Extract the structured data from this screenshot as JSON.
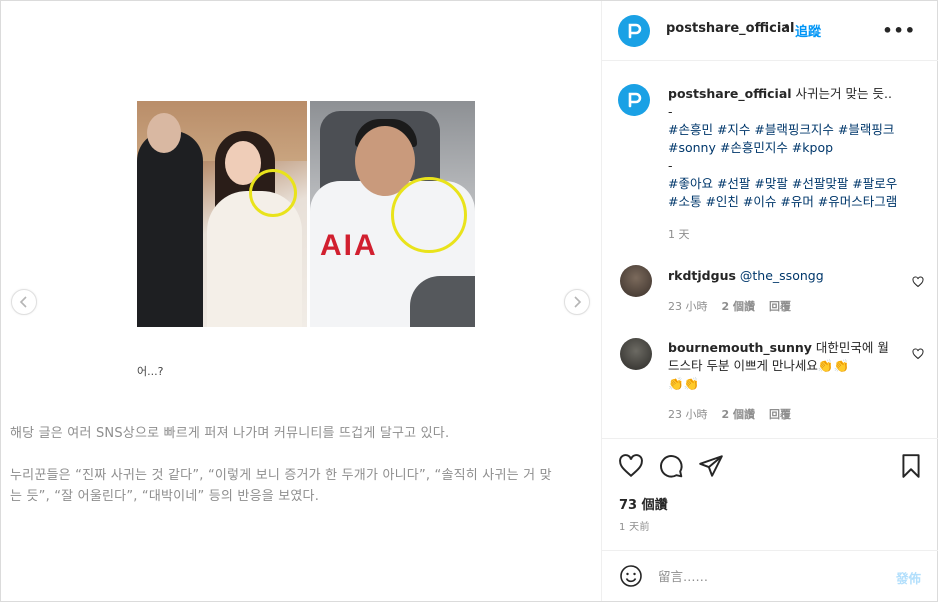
{
  "post": {
    "caption_small": "어...?",
    "body_line1": "해당 글은 여러 SNS상으로 빠르게 퍼져 나가며 커뮤니티를 뜨겁게 달구고 있다.",
    "body_line2": "누리꾼들은 “진짜 사귀는 것 같다”, “이렇게 보니 증거가 한 두개가 아니다”, “솔직히 사귀는 거 맞",
    "body_line3": "는 듯”, “잘 어울린다”, “대박이네” 등의 반응을 보였다.",
    "photo_text": "AIA"
  },
  "header": {
    "username": "postshare_official",
    "separator": "•",
    "follow_label": "追蹤",
    "more_label": "•••"
  },
  "caption": {
    "username": "postshare_official",
    "text": "사귀는거 맞는 듯..",
    "dash1": "-",
    "tags_line1": "#손흥민 #지수 #블랙핑크지수 #블랙핑크",
    "tags_line2": "#sonny #손흥민지수 #kpop",
    "dash2": "-",
    "tags_line3": "#좋아요 #선팔 #맞팔 #선팔맞팔 #팔로우",
    "tags_line4": "#소통 #인친 #이슈 #유머 #유머스타그램",
    "time": "1 天"
  },
  "comments": [
    {
      "username": "rkdtjdgus",
      "text": "@the_ssongg",
      "time": "23 小時",
      "likes": "2 個讚",
      "reply": "回覆"
    },
    {
      "username": "bournemouth_sunny",
      "text_line1": "대한민국에 월",
      "text_line2": "드스타 두분 이쁘게 만나세요👏👏",
      "text_line3": "👏👏",
      "time": "23 小時",
      "likes": "2 個讚",
      "reply": "回覆"
    }
  ],
  "stats": {
    "likes": "73 個讚",
    "time": "1 天前"
  },
  "comment_box": {
    "placeholder": "留言……",
    "post_label": "發佈"
  },
  "colors": {
    "accent": "#0095f6",
    "logo": "#1aa1e5",
    "hashtag": "#00376b",
    "muted": "#8e8e8e",
    "circle": "#e9e31b"
  }
}
